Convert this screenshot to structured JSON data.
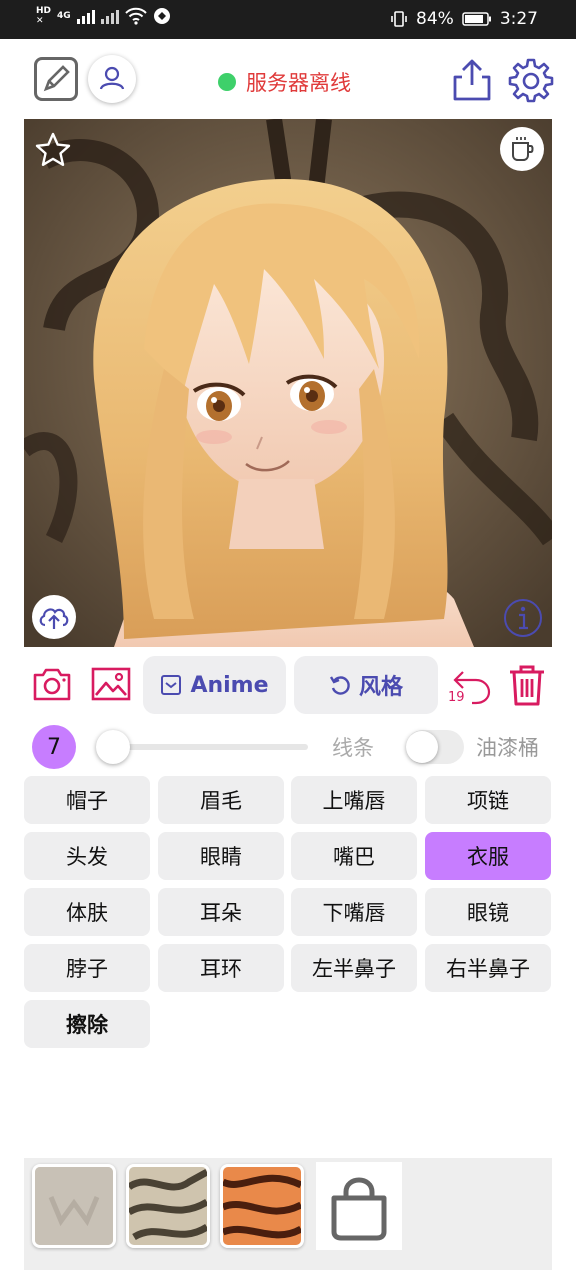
{
  "status_bar": {
    "network_badge": "HD",
    "network_type": "4G",
    "battery_percent": "84%",
    "time": "3:27"
  },
  "header": {
    "server_status": "服务器离线",
    "server_status_color": "#3ed06a",
    "icons": [
      "edit-icon",
      "user-icon",
      "share-icon",
      "gear-icon"
    ]
  },
  "canvas": {
    "overlay_icons": [
      "star-icon",
      "coffee-cup-icon",
      "cloud-upload-icon",
      "info-icon"
    ]
  },
  "toolbar": {
    "anime_label": "Anime",
    "style_label": "风格",
    "undo_count": "19"
  },
  "brush": {
    "size": "7",
    "line_label": "线条",
    "bucket_label": "油漆桶",
    "slider_value": 0,
    "bucket_enabled": false
  },
  "categories": [
    {
      "label": "帽子"
    },
    {
      "label": "眉毛"
    },
    {
      "label": "上嘴唇"
    },
    {
      "label": "项链"
    },
    {
      "label": "头发"
    },
    {
      "label": "眼睛"
    },
    {
      "label": "嘴巴"
    },
    {
      "label": "衣服"
    },
    {
      "label": "体肤"
    },
    {
      "label": "耳朵"
    },
    {
      "label": "下嘴唇"
    },
    {
      "label": "眼镜"
    },
    {
      "label": "脖子"
    },
    {
      "label": "耳环"
    },
    {
      "label": "左半鼻子"
    },
    {
      "label": "右半鼻子"
    },
    {
      "label": "擦除"
    }
  ],
  "selected_category": "衣服",
  "accent_color": "#c77dff",
  "danger_color": "#d81b60",
  "tray": {
    "thumbnail_count": 3,
    "shop_icon": "shopping-bag-icon"
  }
}
